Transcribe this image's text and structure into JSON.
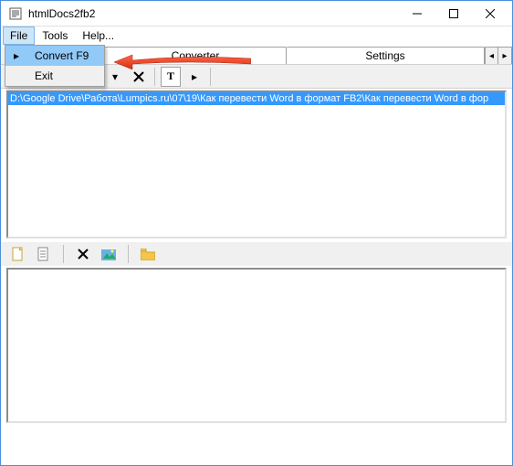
{
  "window": {
    "title": "htmlDocs2fb2"
  },
  "menubar": {
    "items": [
      "File",
      "Tools",
      "Help..."
    ]
  },
  "file_menu": {
    "convert": "Convert F9",
    "exit": "Exit"
  },
  "tabs": {
    "converter": "Converter",
    "settings": "Settings"
  },
  "toolbar": {
    "text_btn": "T"
  },
  "file_list": {
    "selected_path": "D:\\Google Drive\\Работа\\Lumpics.ru\\07\\19\\Как перевести Word в формат FB2\\Как перевести Word в фор"
  }
}
